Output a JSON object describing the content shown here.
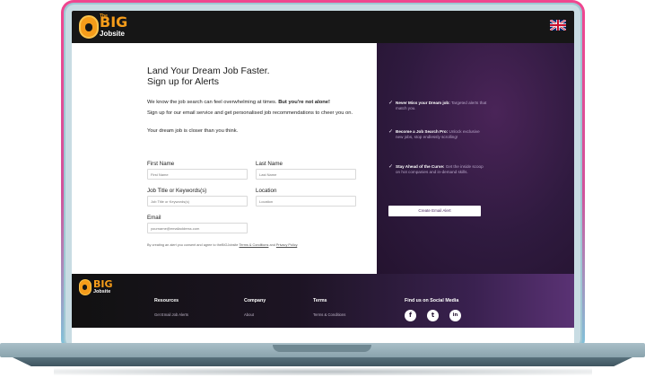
{
  "header": {
    "logo": {
      "the": "The",
      "big": "BIG",
      "jobsite": "Jobsite"
    },
    "language_flag_icon": "uk-flag-icon"
  },
  "form": {
    "title": "Land Your Dream Job Faster.",
    "subtitle": "Sign up for Alerts",
    "intro_plain": "We know the job search can feel overwhelming at times. ",
    "intro_bold": "But you're not alone!",
    "signup_text": "Sign up for our email service and get personalised job recommendations to cheer you on.",
    "closer": "Your dream job is closer than you think.",
    "first_name": {
      "label": "First Name",
      "placeholder": "First Name"
    },
    "last_name": {
      "label": "Last Name",
      "placeholder": "Last Name"
    },
    "job_title": {
      "label": "Job Title or Keywords(s)",
      "placeholder": "Job Title or Keywords(s)"
    },
    "location": {
      "label": "Location",
      "placeholder": "Location"
    },
    "email": {
      "label": "Email",
      "placeholder": "yourname@emailaddress.com"
    },
    "consent_prefix": "By creating an alert you consent and agree to theBIGJobsite ",
    "consent_terms": "Terms & Conditions",
    "consent_and": " and ",
    "consent_privacy": "Privacy Policy",
    "consent_suffix": "."
  },
  "promo": {
    "benefits": [
      {
        "title": "Never Miss your Dream job:",
        "text": " Targeted alerts that match you."
      },
      {
        "title": "Become a Job Search Pro:",
        "text": " Unlock exclusive new jobs, stop endlessly scrolling!"
      },
      {
        "title": "Stay Ahead of the Curve:",
        "text": " Get the inside scoop on hot companies and in-demand skills."
      }
    ],
    "cta_label": "Create Email Alert"
  },
  "footer": {
    "logo": {
      "big": "BIG",
      "jobsite": "Jobsite"
    },
    "resources_heading": "Resources",
    "resources_link": "Get Email Job Alerts",
    "company_heading": "Company",
    "company_link": "About",
    "terms_heading": "Terms",
    "terms_link": "Terms & Conditions",
    "social_heading": "Find us on Social Media",
    "social": [
      {
        "icon": "facebook-icon",
        "glyph": "f"
      },
      {
        "icon": "twitter-icon",
        "glyph": "t"
      },
      {
        "icon": "linkedin-icon",
        "glyph": "in"
      }
    ]
  },
  "colors": {
    "brand_orange": "#f59c1a",
    "header_bg": "#161616",
    "promo_purple": "#2f1a3f",
    "cta_text": "#4b2a63",
    "frame_pink": "#f0468f",
    "frame_blue": "#7ec7dc"
  }
}
